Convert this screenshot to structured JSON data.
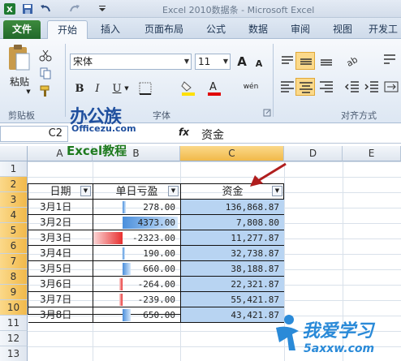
{
  "window": {
    "title": "Excel 2010数据条 - Microsoft Excel"
  },
  "quick_access": [
    "excel-logo-icon",
    "save-icon",
    "undo-icon",
    "redo-icon",
    "customize-icon"
  ],
  "tabs": [
    {
      "label": "文件"
    },
    {
      "label": "开始"
    },
    {
      "label": "插入"
    },
    {
      "label": "页面布局"
    },
    {
      "label": "公式"
    },
    {
      "label": "数据"
    },
    {
      "label": "审阅"
    },
    {
      "label": "视图"
    },
    {
      "label": "开发工"
    }
  ],
  "ribbon": {
    "clipboard": {
      "paste_label": "粘贴",
      "group_label": "剪贴板"
    },
    "font": {
      "name": "宋体",
      "size": "11",
      "group_label": "字体",
      "bold": "B",
      "italic": "I",
      "underline": "U",
      "grow": "A",
      "shrink": "A",
      "wen": "wén"
    },
    "alignment": {
      "group_label": "对齐方式"
    }
  },
  "formula_bar": {
    "name_box": "C2",
    "fx": "fx",
    "value": "资金"
  },
  "watermark": {
    "brand": "办公族",
    "url": "Officezu.com",
    "subtitle": "Excel教程",
    "site_brand": "我爱学习",
    "site_url": "5axxw.com"
  },
  "columns": [
    "A",
    "B",
    "C",
    "D",
    "E"
  ],
  "rows": [
    "1",
    "2",
    "3",
    "4",
    "5",
    "6",
    "7",
    "8",
    "9",
    "10",
    "11",
    "12",
    "13"
  ],
  "table": {
    "headers": [
      "日期",
      "单日亏盈",
      "资金"
    ],
    "dates": [
      "3月1日",
      "3月2日",
      "3月3日",
      "3月4日",
      "3月5日",
      "3月6日",
      "3月7日",
      "3月8日"
    ],
    "daily": [
      "278.00",
      "4373.00",
      "-2323.00",
      "190.00",
      "660.00",
      "-264.00",
      "-239.00",
      "650.00"
    ],
    "daily_values": [
      278,
      4373,
      -2323,
      190,
      660,
      -264,
      -239,
      650
    ],
    "funds": [
      "136,868.87",
      "7,808.80",
      "11,277.87",
      "32,738.87",
      "38,188.87",
      "22,321.87",
      "55,421.87",
      "43,421.87"
    ]
  },
  "colors": {
    "positive_bar": "#4a8fdc",
    "negative_bar": "#e83030",
    "file_tab": "#2d7a33",
    "selection": "#b8d4f2",
    "arrow": "#b01e1e"
  }
}
